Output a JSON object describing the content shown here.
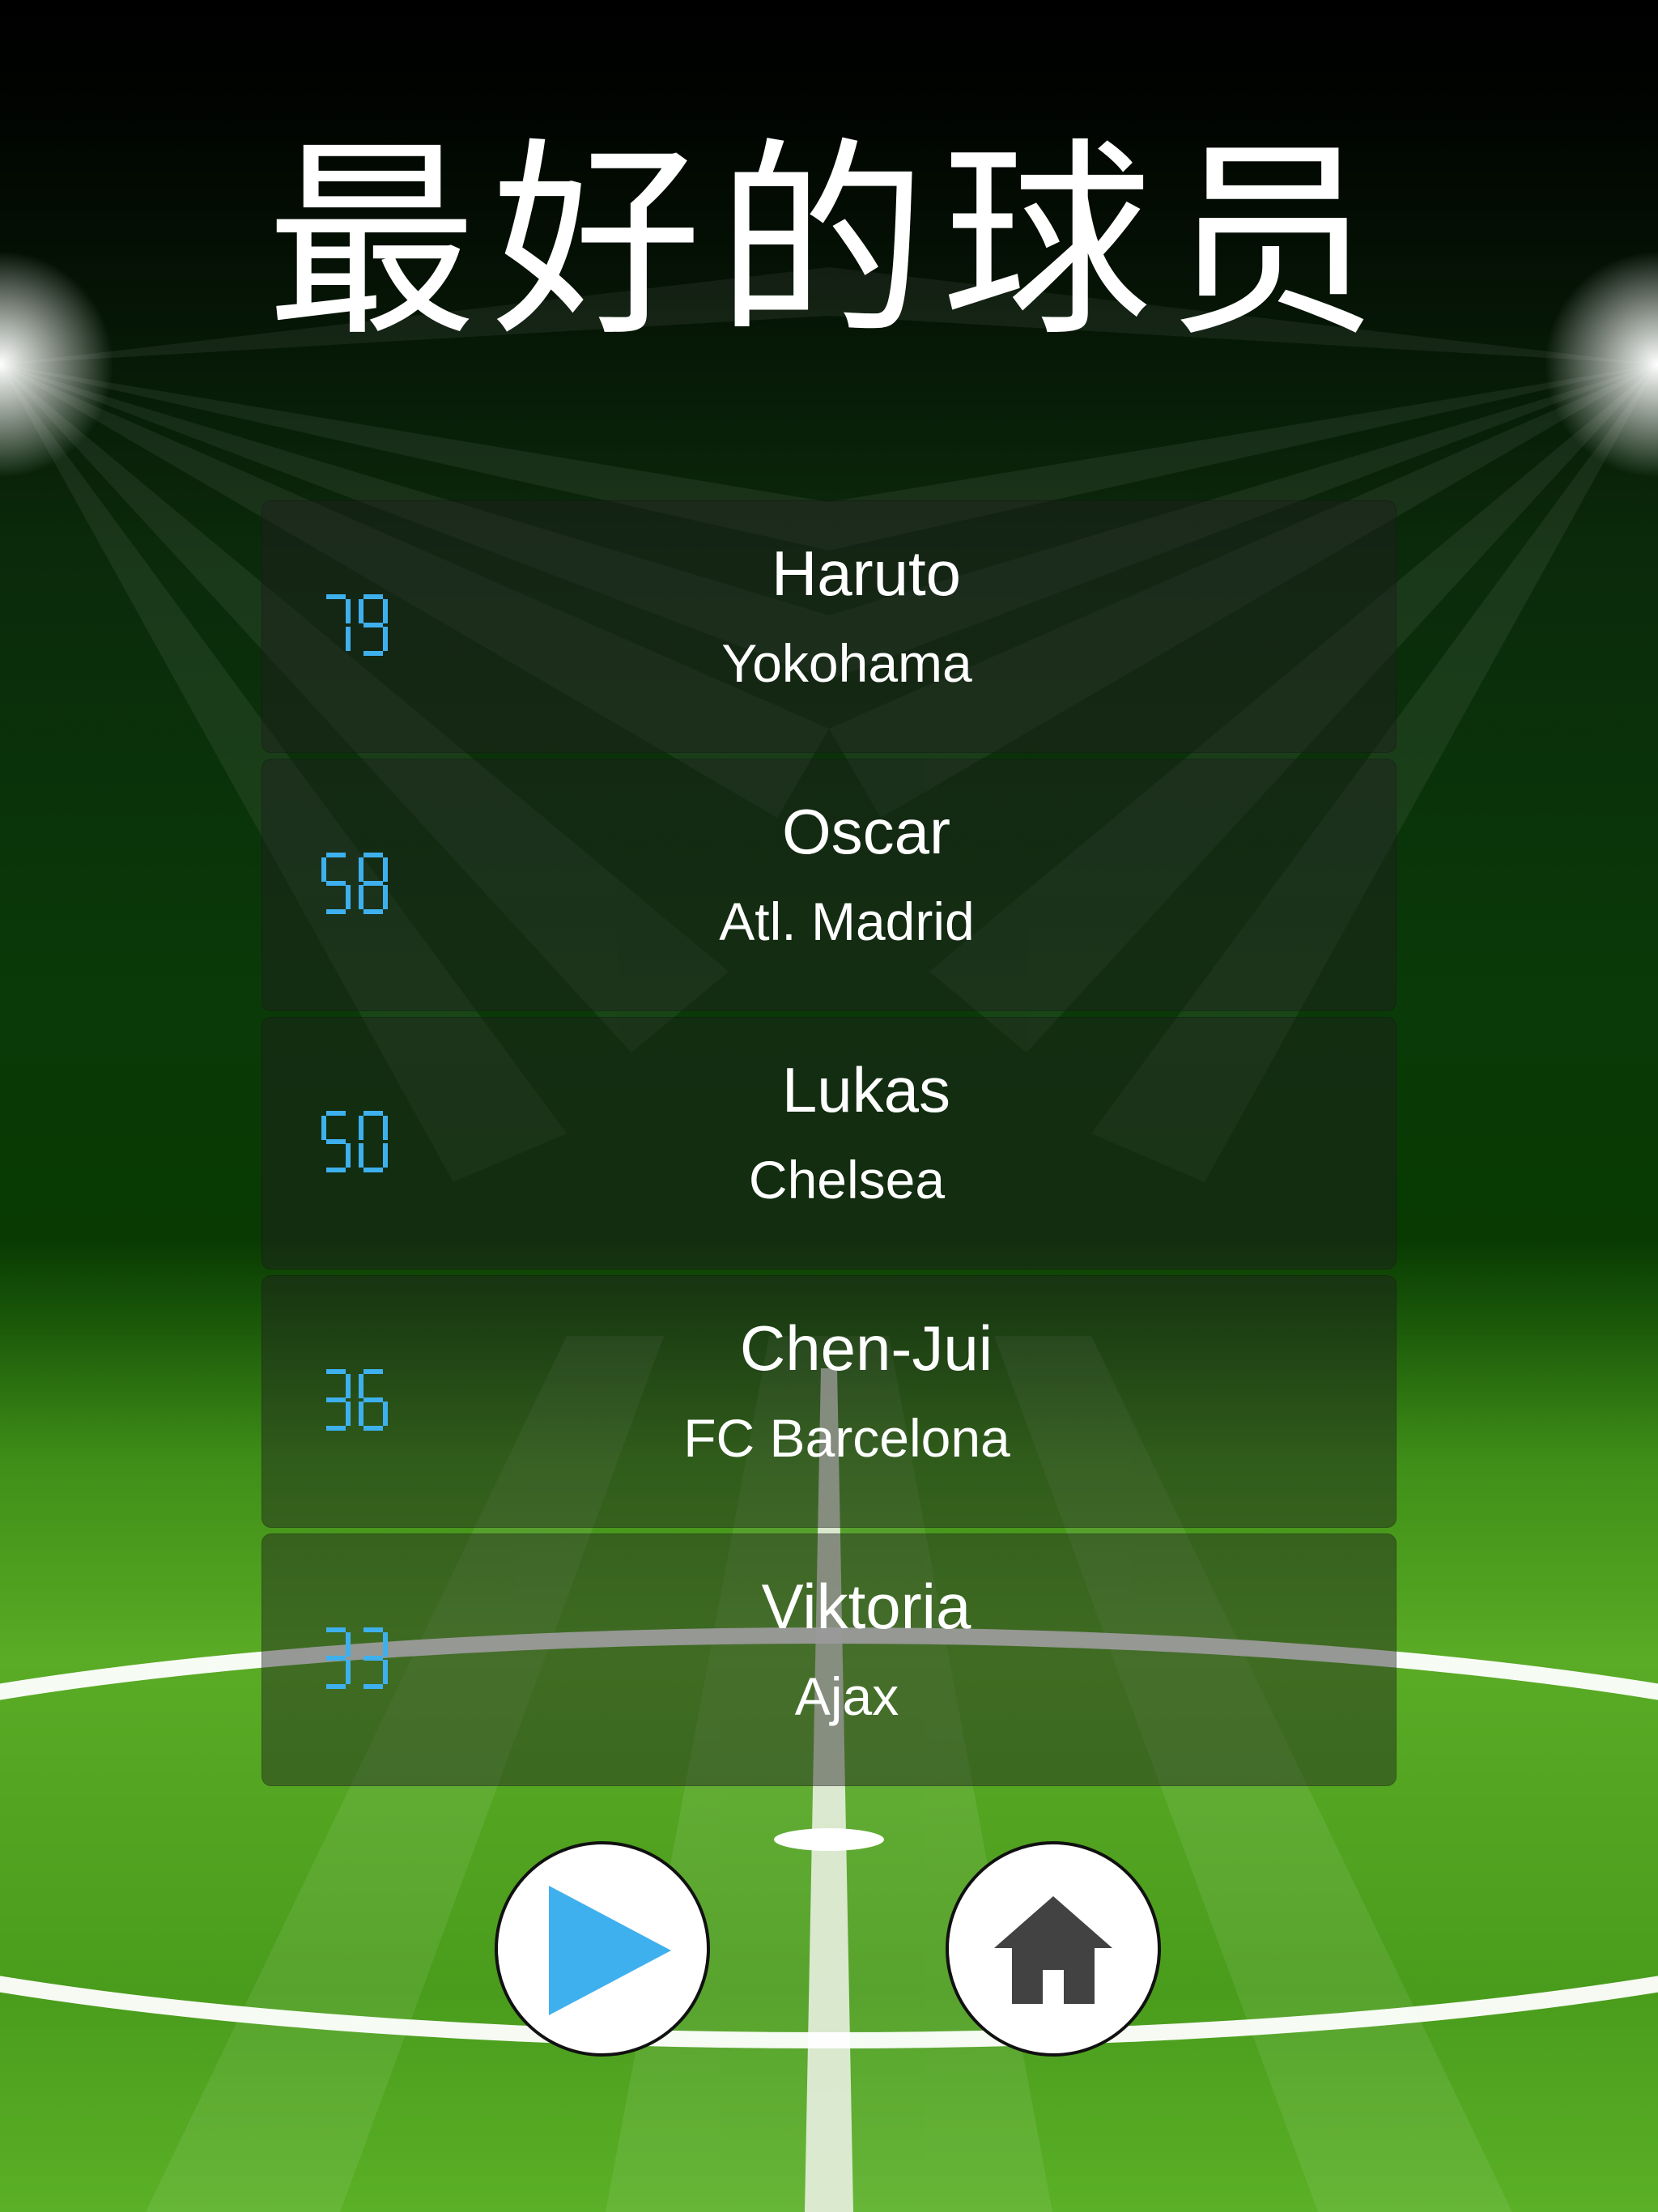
{
  "title": "最好的球员",
  "leaderboard": [
    {
      "score": "79",
      "name": "Haruto",
      "team": "Yokohama"
    },
    {
      "score": "58",
      "name": "Oscar",
      "team": "Atl. Madrid"
    },
    {
      "score": "50",
      "name": "Lukas",
      "team": "Chelsea"
    },
    {
      "score": "36",
      "name": "Chen-Jui",
      "team": "FC Barcelona"
    },
    {
      "score": "33",
      "name": "Viktoria",
      "team": "Ajax"
    }
  ],
  "buttons": {
    "play_icon": "play-icon",
    "home_icon": "home-icon"
  },
  "colors": {
    "score_digits": "#3fb0ee",
    "play_icon": "#3fb0ee",
    "home_icon": "#424242",
    "pitch_light": "#6fbf2e",
    "pitch_dark": "#1f5a08"
  }
}
